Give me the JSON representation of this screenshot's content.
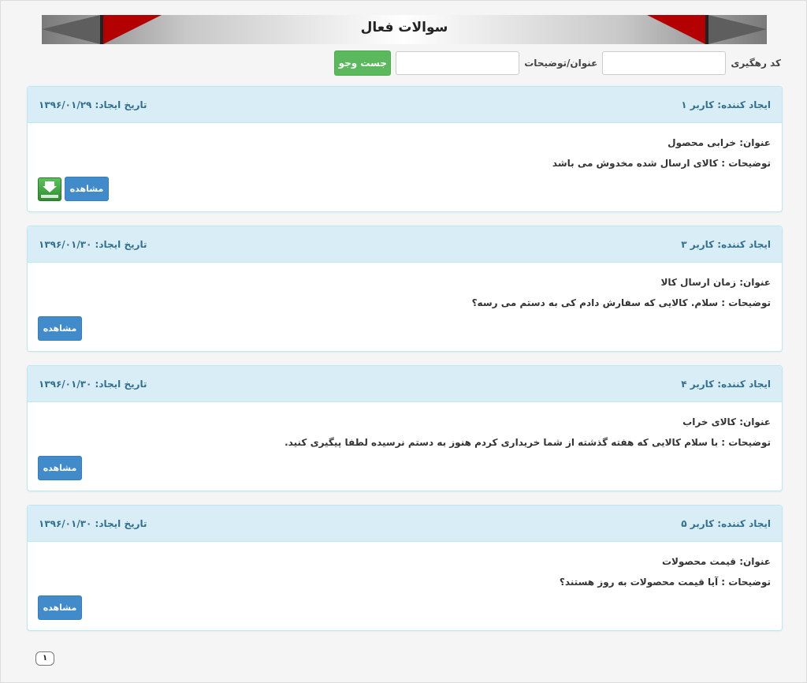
{
  "header": {
    "title": "سوالات فعال"
  },
  "search": {
    "tracking_code_label": "کد رهگیری",
    "tracking_code_value": "",
    "title_desc_label": "عنوان/توضیحات",
    "title_desc_value": "",
    "search_button": "جست وجو"
  },
  "questions": [
    {
      "creator": "ایجاد کننده: کاربر ۱",
      "date": "تاریخ ایجاد: ۱۳۹۶/۰۱/۲۹",
      "title": "عنوان: خرابی محصول",
      "description": "توضیحات : کالای ارسال شده مخدوش می باشد",
      "view_button": "مشاهده",
      "has_attachment": true,
      "attachment_icon": "download-icon"
    },
    {
      "creator": "ایجاد کننده: کاربر ۳",
      "date": "تاریخ ایجاد: ۱۳۹۶/۰۱/۳۰",
      "title": "عنوان: زمان ارسال کالا",
      "description": "توضیحات : سلام. کالایی که سفارش دادم کی به دستم می رسه؟",
      "view_button": "مشاهده",
      "has_attachment": false
    },
    {
      "creator": "ایجاد کننده: کاربر ۴",
      "date": "تاریخ ایجاد: ۱۳۹۶/۰۱/۳۰",
      "title": "عنوان: کالای خراب",
      "description": "توضیحات : با سلام کالایی که هفته گذشته از شما خریداری کردم هنوز به دستم نرسیده لطفا پیگیری کنید.",
      "view_button": "مشاهده",
      "has_attachment": false
    },
    {
      "creator": "ایجاد کننده: کاربر ۵",
      "date": "تاریخ ایجاد: ۱۳۹۶/۰۱/۳۰",
      "title": "عنوان: قیمت محصولات",
      "description": "توضیحات : آیا قیمت محصولات به روز هستند؟",
      "view_button": "مشاهده",
      "has_attachment": false
    }
  ],
  "pagination": {
    "current_page": "۱"
  },
  "colors": {
    "panel_heading_bg": "#d9edf7",
    "panel_heading_text": "#31708f",
    "search_button": "#5cb85c",
    "view_button": "#428bca",
    "banner_accent": "#b30000"
  }
}
